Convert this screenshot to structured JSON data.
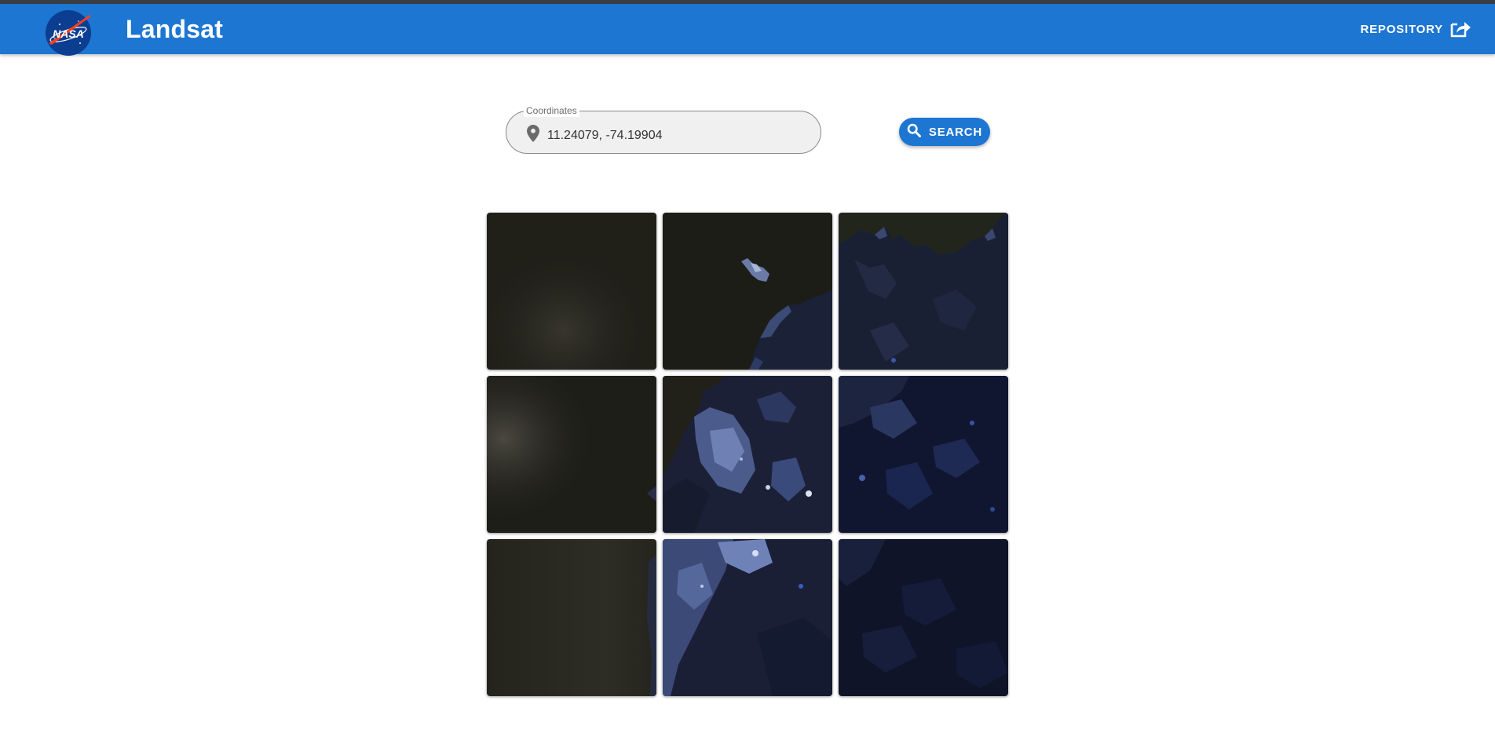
{
  "header": {
    "logo_text": "NASA",
    "title": "Landsat",
    "repository_label": "REPOSITORY",
    "bar_color": "#1c76d2"
  },
  "search": {
    "field_label": "Coordinates",
    "value": "11.24079, -74.19904",
    "button_label": "SEARCH",
    "pin_icon": "location-pin-icon",
    "button_icon": "magnifier-icon"
  },
  "tiles": [
    {
      "row": 1,
      "col": 1,
      "scene": "ocean-haze"
    },
    {
      "row": 1,
      "col": 2,
      "scene": "ocean-coast-island"
    },
    {
      "row": 1,
      "col": 3,
      "scene": "coastal-mountains"
    },
    {
      "row": 2,
      "col": 1,
      "scene": "ocean-cloud"
    },
    {
      "row": 2,
      "col": 2,
      "scene": "coastal-city"
    },
    {
      "row": 2,
      "col": 3,
      "scene": "inland-terrain"
    },
    {
      "row": 3,
      "col": 1,
      "scene": "ocean-haze"
    },
    {
      "row": 3,
      "col": 2,
      "scene": "city-outskirts"
    },
    {
      "row": 3,
      "col": 3,
      "scene": "dark-terrain"
    }
  ]
}
